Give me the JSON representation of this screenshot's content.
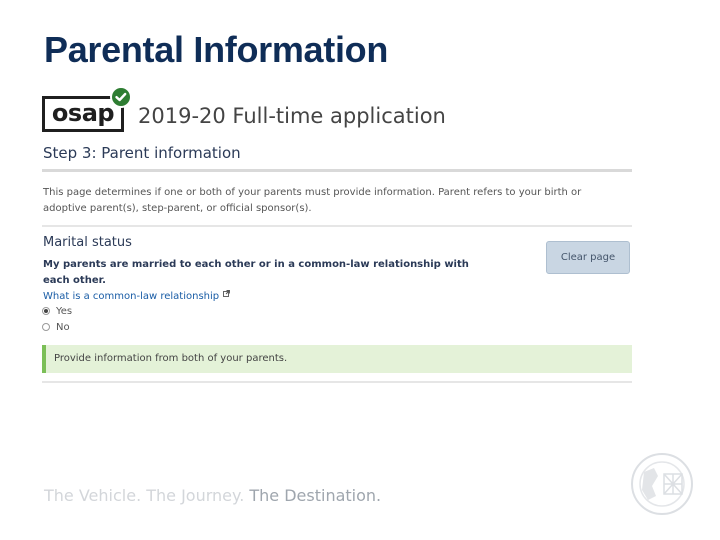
{
  "slide": {
    "title": "Parental Information",
    "tagline": {
      "light": "The Vehicle. The Journey.",
      "strong": "The Destination."
    }
  },
  "app": {
    "logo_text": "osap",
    "heading": "2019-20 Full-time application",
    "step_title": "Step 3: Parent information",
    "intro": "This page determines if one or both of your parents must provide information. Parent refers to your birth or adoptive parent(s), step-parent, or official sponsor(s).",
    "section_title": "Marital status",
    "question": "My parents are married to each other or in a  common-law relationship with each other.",
    "help_link": "What is a common-law relationship",
    "options": [
      {
        "label": "Yes",
        "selected": true
      },
      {
        "label": "No",
        "selected": false
      }
    ],
    "clear_button": "Clear page",
    "alert": "Provide information from both of your parents."
  },
  "colors": {
    "title": "#0f2d57",
    "link": "#1a5da6",
    "alert_bg": "#e4f2d8",
    "alert_border": "#7bbf57",
    "button_bg": "#c9d6e3",
    "badge": "#2e7d32"
  },
  "icons": {
    "badge": "check-circle-icon",
    "external": "external-link-icon",
    "emblem": "crest-emblem-icon"
  }
}
